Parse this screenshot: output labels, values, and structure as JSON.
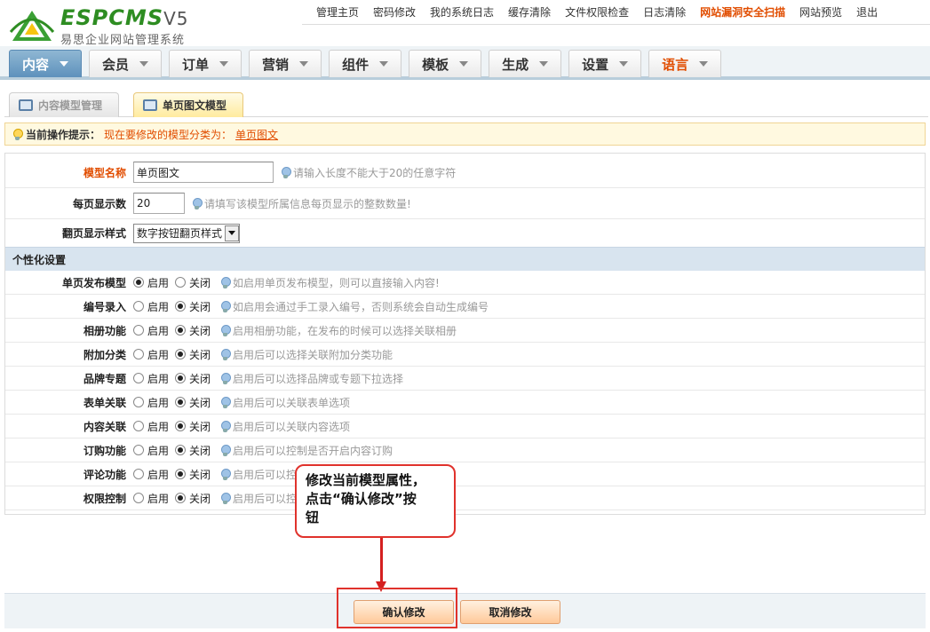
{
  "brand": {
    "logo_text": "ESPCMS",
    "logo_version": "V5",
    "subtitle": "易思企业网站管理系统"
  },
  "toplinks": [
    "管理主页",
    "密码修改",
    "我的系统日志",
    "缓存清除",
    "文件权限检查",
    "日志清除",
    "网站漏洞安全扫描",
    "网站预览",
    "退出"
  ],
  "nav": [
    "内容",
    "会员",
    "订单",
    "营销",
    "组件",
    "模板",
    "生成",
    "设置",
    "语言"
  ],
  "subtabs": {
    "inactive": "内容模型管理",
    "active": "单页图文模型"
  },
  "tip": {
    "label": "当前操作提示：",
    "text": "现在要修改的模型分类为：",
    "link": "单页图文"
  },
  "form": {
    "name": {
      "label": "模型名称",
      "value": "单页图文",
      "hint": "请输入长度不能大于20的任意字符"
    },
    "pagesize": {
      "label": "每页显示数",
      "value": "20",
      "hint": "请填写该模型所属信息每页显示的整数数量!"
    },
    "pagestyle": {
      "label": "翻页显示样式",
      "value": "数字按钮翻页样式"
    }
  },
  "section_title": "个性化设置",
  "radio_labels": {
    "on": "启用",
    "off": "关闭"
  },
  "options": [
    {
      "label": "单页发布模型",
      "hint": "如启用单页发布模型，则可以直接输入内容!",
      "enabled": true
    },
    {
      "label": "编号录入",
      "hint": "如启用会通过手工录入编号，否则系统会自动生成编号",
      "enabled": false
    },
    {
      "label": "相册功能",
      "hint": "启用相册功能，在发布的时候可以选择关联相册",
      "enabled": false
    },
    {
      "label": "附加分类",
      "hint": "启用后可以选择关联附加分类功能",
      "enabled": false
    },
    {
      "label": "品牌专题",
      "hint": "启用后可以选择品牌或专题下拉选择",
      "enabled": false
    },
    {
      "label": "表单关联",
      "hint": "启用后可以关联表单选项",
      "enabled": false
    },
    {
      "label": "内容关联",
      "hint": "启用后可以关联内容选项",
      "enabled": false
    },
    {
      "label": "订购功能",
      "hint": "启用后可以控制是否开启内容订购",
      "enabled": false
    },
    {
      "label": "评论功能",
      "hint": "启用后可以控",
      "enabled": false
    },
    {
      "label": "权限控制",
      "hint": "启用后可以控",
      "enabled": false
    }
  ],
  "callout": {
    "line1": "修改当前模型属性，",
    "line2": "点击“确认修改”按",
    "line3": "钮"
  },
  "buttons": {
    "confirm": "确认修改",
    "cancel": "取消修改"
  },
  "colors": {
    "accent": "#e14d00",
    "nav_active": "#6a9cc4",
    "section_bg": "#d8e4ef",
    "callout_border": "#e0322c"
  }
}
